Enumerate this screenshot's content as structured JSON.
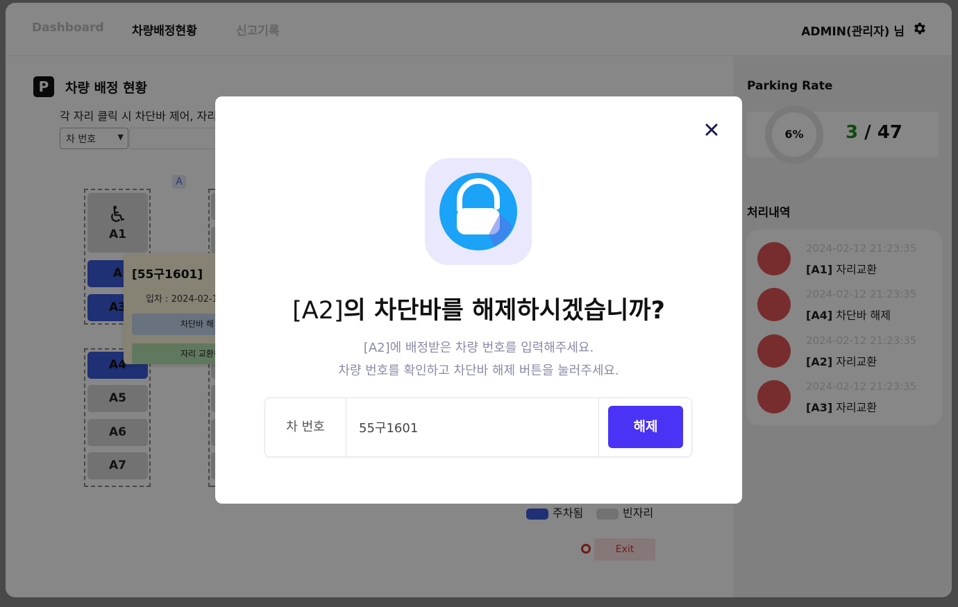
{
  "nav": {
    "items": [
      "Dashboard",
      "차량배정현황",
      "신고기록"
    ],
    "admin": "ADMIN(관리자) 님"
  },
  "main": {
    "title": "차량 배정 현황",
    "desc": "각 자리 클릭 시 차단바 제어, 자리",
    "filter_select": "차 번호",
    "zone": "A",
    "slots": [
      {
        "label": "A1",
        "state": "disabled-empty"
      },
      {
        "label": "A",
        "state": "parked"
      },
      {
        "label": "A3",
        "state": "parked"
      },
      {
        "label": "A4",
        "state": "parked"
      },
      {
        "label": "A5",
        "state": "empty"
      },
      {
        "label": "A6",
        "state": "empty"
      },
      {
        "label": "A7",
        "state": "empty"
      }
    ],
    "popover": {
      "car": "[55구1601]",
      "entry": "입차 : 2024-02-1",
      "release": "차단바 해",
      "swap": "자리 교환하"
    },
    "legend": {
      "parked": "주차됨",
      "empty": "빈자리"
    },
    "exit": "Exit"
  },
  "side": {
    "rate_title": "Parking Rate",
    "rate_percent": "6%",
    "rate_used": "3",
    "rate_sep": " / ",
    "rate_total": "47",
    "history_title": "처리내역",
    "history": [
      {
        "time": "2024-02-12 21:23:35",
        "slot": "[A1]",
        "action": "자리교환"
      },
      {
        "time": "2024-02-12 21:23:35",
        "slot": "[A4]",
        "action": "차단바 해제"
      },
      {
        "time": "2024-02-12 21:23:35",
        "slot": "[A2]",
        "action": "자리교환"
      },
      {
        "time": "2024-02-12 21:23:35",
        "slot": "[A3]",
        "action": "자리교환"
      }
    ]
  },
  "modal": {
    "title_slot": "[A2]",
    "title_rest": "의 차단바를 해제하시겠습니까?",
    "desc_line1": "[A2]에 배정받은 차량 번호를 입력해주세요.",
    "desc_line2": "차량 번호를 확인하고 차단바 해제 버튼을 눌러주세요.",
    "input_label": "차 번호",
    "input_value": "55구1601",
    "confirm": "해제"
  },
  "colors": {
    "accent": "#4a33f5",
    "parked": "#3b5bdb",
    "alert": "#e15656",
    "lock": "#1aa3f7"
  }
}
